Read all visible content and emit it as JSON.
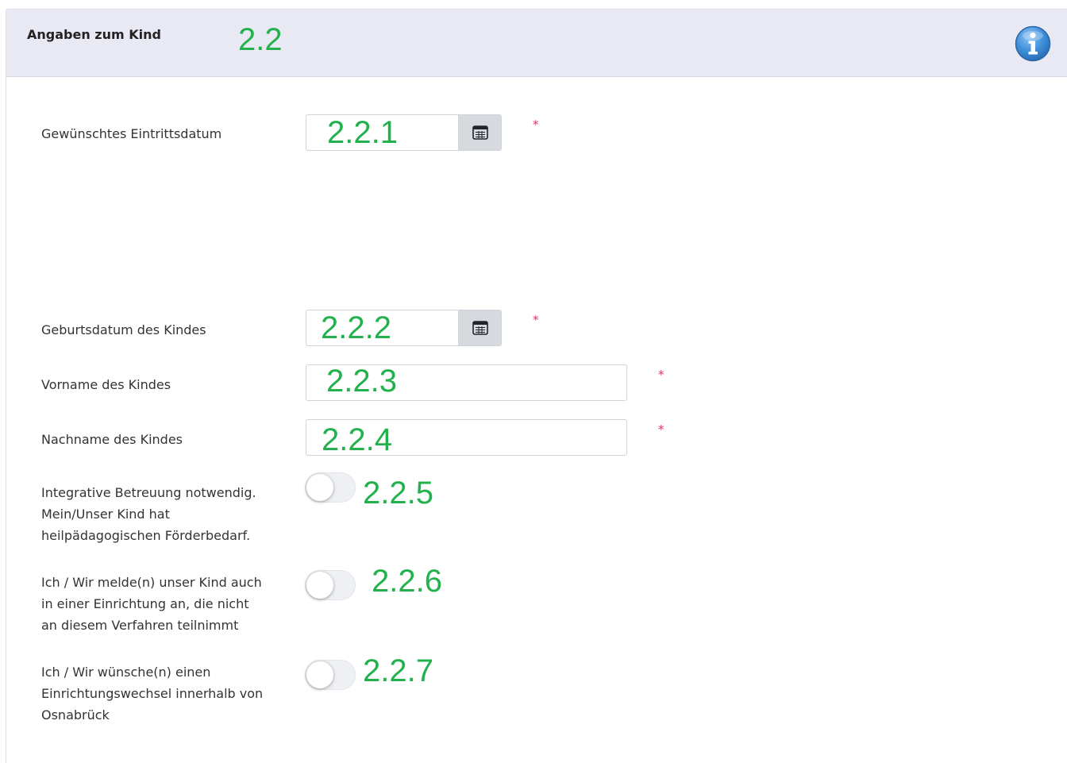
{
  "section": {
    "title": "Angaben zum Kind",
    "annotation": "2.2"
  },
  "icons": {
    "info": "info-icon",
    "calendar": "calendar-icon"
  },
  "colors": {
    "header_bg": "#e8e9f3",
    "annotation": "#22b14c",
    "required": "#d6336c",
    "info_icon": "#3f8fd9"
  },
  "fields": {
    "entry_date": {
      "label": "Gewünschtes Eintrittsdatum",
      "annotation": "2.2.1",
      "value": "",
      "required_mark": "*"
    },
    "birth_date": {
      "label": "Geburtsdatum des Kindes",
      "annotation": "2.2.2",
      "value": "",
      "required_mark": "*"
    },
    "first_name": {
      "label": "Vorname des Kindes",
      "annotation": "2.2.3",
      "value": "",
      "required_mark": "*"
    },
    "last_name": {
      "label": "Nachname des Kindes",
      "annotation": "2.2.4",
      "value": "",
      "required_mark": "*"
    },
    "integrative": {
      "label_lines": [
        "Integrative Betreuung notwendig.",
        "Mein/Unser Kind hat",
        "heilpädagogischen Förderbedarf."
      ],
      "annotation": "2.2.5",
      "checked": false
    },
    "other_facility": {
      "label_lines": [
        "Ich / Wir melde(n) unser Kind auch",
        "in einer Einrichtung an, die nicht",
        "an diesem Verfahren teilnimmt"
      ],
      "annotation": "2.2.6",
      "checked": false
    },
    "facility_change": {
      "label_lines": [
        "Ich / Wir wünsche(n) einen",
        "Einrichtungswechsel innerhalb von",
        "Osnabrück"
      ],
      "annotation": "2.2.7",
      "checked": false
    }
  }
}
